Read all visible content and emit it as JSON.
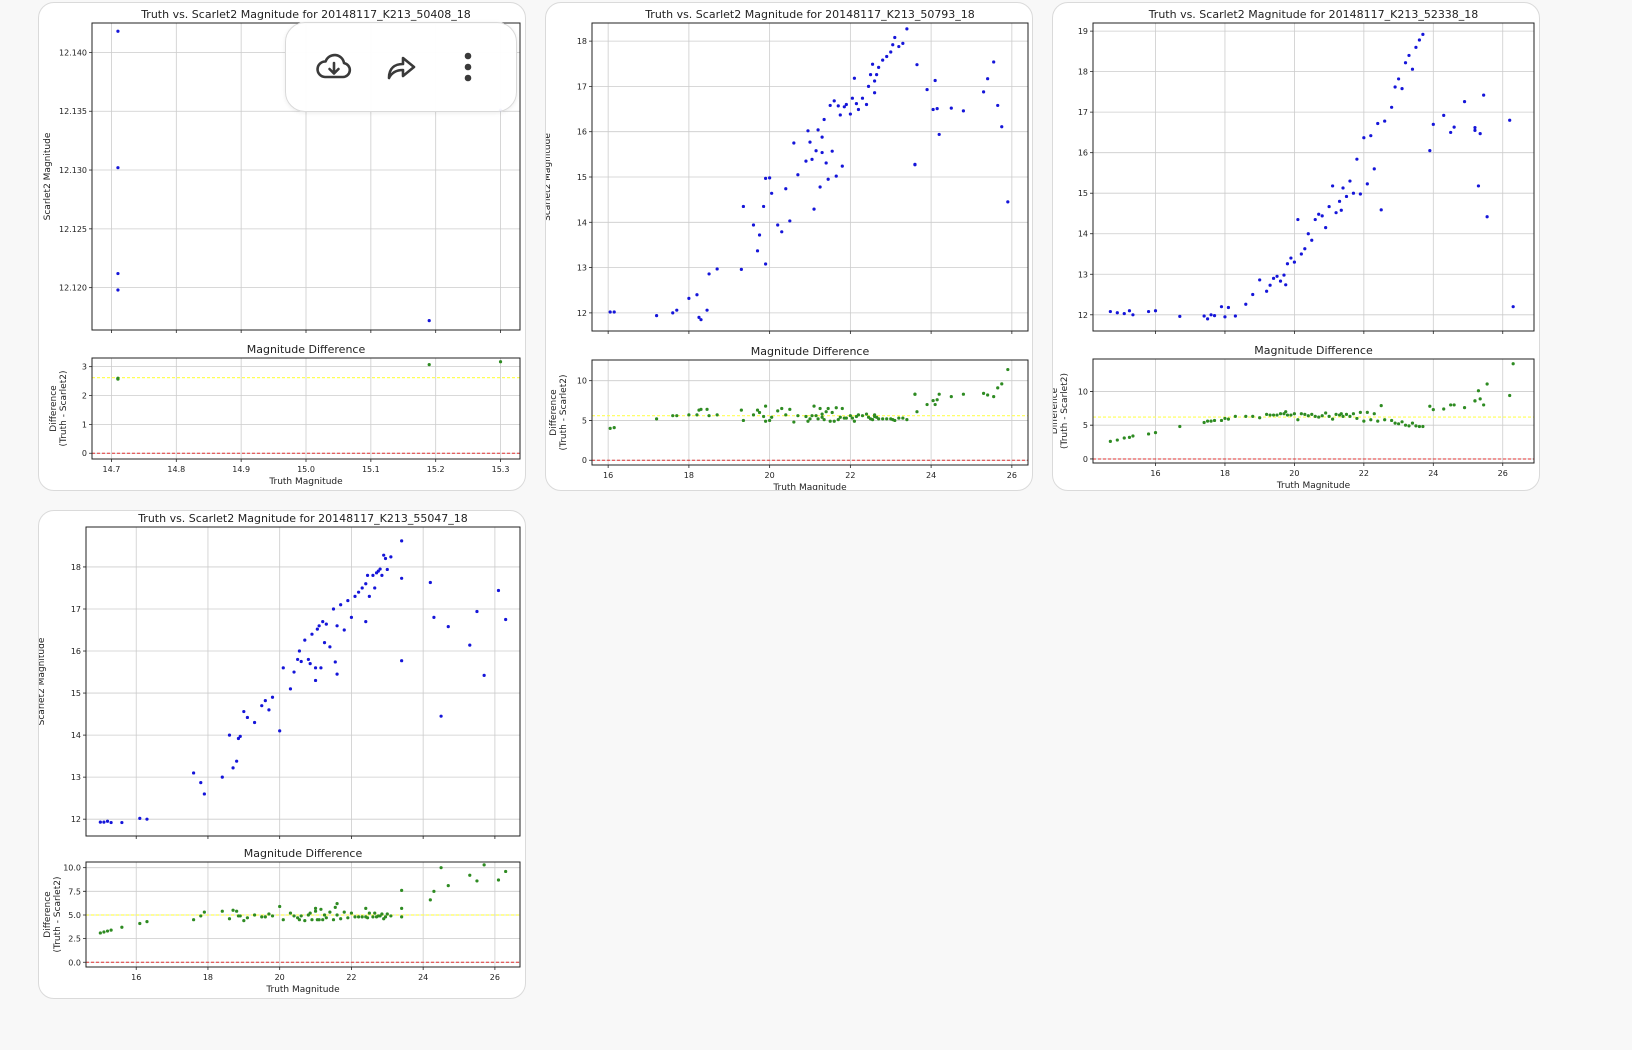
{
  "menu": {
    "icons": [
      "cloud-download-icon",
      "share-arrow-icon",
      "more-vertical-icon"
    ]
  },
  "colors": {
    "scatter": "#1515d9",
    "diff": "#2e8b22",
    "yellow_line": "#ffff55",
    "red_line": "#e03030",
    "grid": "#cccccc"
  },
  "chart_data": [
    {
      "type": "scatter",
      "title": "Truth vs. Scarlet2 Magnitude for 20148117_K213_50408_18",
      "ylabel": "Scarlet2 Magnitude",
      "diff_title": "Magnitude Difference",
      "diff_ylabel_1": "Difference",
      "diff_ylabel_2": "(Truth - Scarlet2)",
      "xlabel": "Truth Magnitude",
      "xlim": [
        14.67,
        15.33
      ],
      "xticks": [
        "14.7",
        "14.8",
        "14.9",
        "15.0",
        "15.1",
        "15.2",
        "15.3"
      ],
      "xtick_values": [
        14.7,
        14.8,
        14.9,
        15.0,
        15.1,
        15.2,
        15.3
      ],
      "ylim": [
        12.1164,
        12.1425
      ],
      "yticks": [
        "12.120",
        "12.125",
        "12.130",
        "12.135",
        "12.140"
      ],
      "ytick_values": [
        12.12,
        12.125,
        12.13,
        12.135,
        12.14
      ],
      "dylim": [
        -0.2,
        3.3
      ],
      "dyticks": [
        "0",
        "1",
        "2",
        "3"
      ],
      "dytick_values": [
        0,
        1,
        2,
        3
      ],
      "mean_diff": 2.62,
      "x": [
        14.71,
        14.71,
        14.71,
        14.71,
        15.19,
        15.3
      ],
      "y": [
        12.1418,
        12.1302,
        12.1212,
        12.1198,
        12.1172,
        12.1351
      ],
      "diff": [
        2.57,
        2.58,
        2.59,
        2.6,
        3.07,
        3.17
      ]
    },
    {
      "type": "scatter",
      "title": "Truth vs. Scarlet2 Magnitude for 20148117_K213_50793_18",
      "ylabel": "Scarlet2 Magnitude",
      "diff_title": "Magnitude Difference",
      "diff_ylabel_1": "Difference",
      "diff_ylabel_2": "(Truth - Scarlet2)",
      "xlabel": "Truth Magnitude",
      "xlim": [
        15.6,
        26.4
      ],
      "xticks": [
        "16",
        "18",
        "20",
        "22",
        "24",
        "26"
      ],
      "xtick_values": [
        16,
        18,
        20,
        22,
        24,
        26
      ],
      "ylim": [
        11.6,
        18.4
      ],
      "yticks": [
        "12",
        "13",
        "14",
        "15",
        "16",
        "17",
        "18"
      ],
      "ytick_values": [
        12,
        13,
        14,
        15,
        16,
        17,
        18
      ],
      "dylim": [
        -0.6,
        12.6
      ],
      "dyticks": [
        "0",
        "5",
        "10"
      ],
      "dytick_values": [
        0,
        5,
        10
      ],
      "mean_diff": 5.6,
      "x": [
        16.05,
        16.15,
        17.2,
        17.6,
        17.7,
        18.0,
        18.2,
        18.25,
        18.3,
        18.45,
        18.5,
        18.7,
        19.3,
        19.35,
        19.6,
        19.7,
        19.75,
        19.85,
        19.9,
        20.0,
        20.05,
        20.2,
        20.3,
        20.5,
        20.6,
        20.7,
        20.9,
        20.95,
        21.0,
        21.05,
        21.1,
        21.15,
        21.2,
        21.25,
        21.3,
        21.35,
        21.4,
        21.45,
        21.5,
        21.55,
        21.6,
        21.65,
        21.7,
        21.75,
        21.8,
        21.85,
        21.9,
        22.0,
        22.05,
        22.1,
        22.15,
        22.2,
        22.3,
        22.4,
        22.45,
        22.5,
        22.55,
        22.6,
        22.65,
        22.7,
        22.8,
        22.9,
        23.0,
        23.05,
        23.1,
        23.2,
        23.3,
        23.4,
        23.6,
        23.65,
        23.9,
        24.05,
        24.15,
        24.2,
        24.5,
        24.8,
        25.3,
        25.4,
        25.55,
        25.65,
        25.75,
        25.9,
        24.1,
        23.6,
        21.3,
        20.4,
        19.9,
        22.6
      ],
      "y": [
        12.02,
        12.02,
        11.94,
        12.0,
        12.06,
        12.32,
        12.4,
        11.9,
        11.85,
        12.06,
        12.86,
        12.97,
        12.96,
        14.35,
        13.94,
        13.37,
        13.72,
        14.35,
        13.08,
        14.98,
        14.64,
        13.94,
        13.79,
        14.03,
        15.75,
        15.05,
        15.35,
        16.02,
        15.77,
        15.39,
        14.29,
        15.58,
        16.04,
        14.78,
        15.88,
        16.27,
        15.31,
        14.95,
        16.58,
        15.57,
        16.68,
        15.02,
        16.57,
        16.37,
        15.24,
        16.55,
        16.6,
        16.39,
        16.74,
        17.18,
        16.62,
        16.49,
        16.74,
        16.6,
        17.0,
        17.26,
        17.49,
        17.12,
        17.26,
        17.42,
        17.58,
        17.66,
        17.76,
        17.92,
        18.08,
        17.88,
        17.95,
        18.27,
        15.28,
        17.48,
        16.93,
        16.49,
        16.51,
        15.94,
        16.52,
        16.46,
        16.88,
        17.17,
        17.54,
        16.58,
        16.11,
        14.45,
        17.13,
        15.27,
        15.54,
        14.74,
        14.97,
        16.86
      ],
      "diff": [
        4.0,
        4.1,
        5.2,
        5.6,
        5.6,
        5.7,
        5.7,
        6.3,
        6.4,
        6.4,
        5.6,
        5.7,
        6.3,
        5.0,
        5.7,
        6.3,
        6.0,
        5.5,
        6.8,
        5.0,
        5.4,
        6.2,
        6.5,
        6.4,
        4.8,
        5.6,
        5.5,
        4.9,
        5.2,
        5.6,
        6.8,
        5.6,
        5.2,
        6.5,
        5.4,
        5.1,
        6.1,
        6.5,
        4.9,
        6.0,
        4.9,
        6.6,
        5.1,
        5.4,
        6.5,
        5.3,
        5.3,
        5.6,
        5.3,
        4.9,
        5.5,
        5.7,
        5.6,
        5.8,
        5.4,
        5.2,
        5.1,
        5.5,
        5.4,
        5.2,
        5.2,
        5.2,
        5.2,
        5.1,
        5.0,
        5.3,
        5.3,
        5.1,
        8.3,
        6.1,
        7.0,
        7.5,
        7.6,
        8.3,
        8.0,
        8.3,
        8.4,
        8.2,
        8.0,
        9.1,
        9.6,
        11.4,
        7.0,
        8.3,
        5.8,
        5.7,
        4.9,
        5.7
      ]
    },
    {
      "type": "scatter",
      "title": "Truth vs. Scarlet2 Magnitude for 20148117_K213_52338_18",
      "ylabel": "Scarlet2 Magnitude",
      "diff_title": "Magnitude Difference",
      "diff_ylabel_1": "Difference",
      "diff_ylabel_2": "(Truth - Scarlet2)",
      "xlabel": "Truth Magnitude",
      "xlim": [
        14.2,
        26.9
      ],
      "xticks": [
        "16",
        "18",
        "20",
        "22",
        "24",
        "26"
      ],
      "xtick_values": [
        16,
        18,
        20,
        22,
        24,
        26
      ],
      "ylim": [
        11.6,
        19.2
      ],
      "yticks": [
        "12",
        "13",
        "14",
        "15",
        "16",
        "17",
        "18",
        "19"
      ],
      "ytick_values": [
        12,
        13,
        14,
        15,
        16,
        17,
        18,
        19
      ],
      "dylim": [
        -0.6,
        14.8
      ],
      "dyticks": [
        "0",
        "5",
        "10"
      ],
      "dytick_values": [
        0,
        5,
        10
      ],
      "mean_diff": 6.2,
      "x": [
        14.7,
        14.9,
        15.1,
        15.25,
        15.35,
        15.8,
        16.0,
        16.7,
        17.4,
        17.5,
        17.6,
        17.7,
        17.9,
        18.0,
        18.1,
        18.3,
        18.6,
        18.8,
        19.0,
        19.2,
        19.3,
        19.4,
        19.5,
        19.6,
        19.7,
        19.75,
        19.8,
        19.9,
        20.0,
        20.1,
        20.2,
        20.3,
        20.4,
        20.5,
        20.6,
        20.7,
        20.8,
        20.9,
        21.0,
        21.1,
        21.2,
        21.3,
        21.35,
        21.4,
        21.5,
        21.6,
        21.7,
        21.8,
        21.9,
        22.0,
        22.1,
        22.2,
        22.3,
        22.4,
        22.5,
        22.6,
        22.8,
        22.9,
        23.0,
        23.1,
        23.2,
        23.3,
        23.4,
        23.5,
        23.6,
        23.7,
        23.9,
        24.0,
        24.3,
        24.5,
        24.6,
        24.9,
        25.2,
        25.3,
        25.35,
        25.45,
        25.55,
        26.2,
        26.3,
        25.2
      ],
      "y": [
        12.08,
        12.05,
        12.03,
        12.1,
        12.0,
        12.08,
        12.1,
        11.96,
        11.97,
        11.9,
        12.0,
        11.98,
        12.2,
        11.95,
        12.18,
        11.97,
        12.26,
        12.5,
        12.86,
        12.58,
        12.73,
        12.9,
        12.95,
        12.83,
        12.98,
        12.74,
        13.26,
        13.4,
        13.3,
        14.35,
        13.5,
        13.63,
        14.0,
        13.84,
        14.35,
        14.48,
        14.44,
        14.15,
        14.67,
        15.18,
        14.52,
        14.8,
        14.58,
        15.13,
        14.92,
        15.3,
        15.0,
        15.84,
        14.98,
        16.37,
        15.23,
        16.42,
        15.6,
        16.72,
        14.59,
        16.78,
        17.12,
        17.62,
        17.82,
        17.58,
        18.22,
        18.4,
        18.06,
        18.6,
        18.78,
        18.92,
        16.05,
        16.7,
        16.92,
        16.5,
        16.63,
        17.26,
        16.62,
        15.18,
        16.47,
        17.42,
        14.42,
        16.8,
        12.2,
        16.55
      ],
      "diff": [
        2.6,
        2.8,
        3.1,
        3.2,
        3.4,
        3.7,
        3.9,
        4.8,
        5.4,
        5.6,
        5.6,
        5.7,
        5.7,
        6.0,
        5.9,
        6.3,
        6.3,
        6.3,
        6.1,
        6.6,
        6.5,
        6.5,
        6.5,
        6.7,
        6.7,
        7.0,
        6.5,
        6.5,
        6.7,
        5.8,
        6.7,
        6.6,
        6.4,
        6.6,
        6.3,
        6.2,
        6.4,
        6.8,
        6.3,
        5.9,
        6.6,
        6.5,
        6.7,
        6.3,
        6.6,
        6.3,
        6.7,
        6.0,
        6.9,
        5.6,
        6.9,
        5.8,
        6.7,
        5.6,
        7.9,
        5.8,
        5.7,
        5.3,
        5.2,
        5.5,
        5.0,
        4.9,
        5.3,
        4.9,
        4.8,
        4.8,
        7.8,
        7.3,
        7.4,
        8.0,
        8.0,
        7.6,
        8.6,
        10.1,
        8.9,
        8.0,
        11.1,
        9.4,
        14.1,
        8.6
      ]
    },
    {
      "type": "scatter",
      "title": "Truth vs. Scarlet2 Magnitude for 20148117_K213_55047_18",
      "ylabel": "Scarlet2 Magnitude",
      "diff_title": "Magnitude Difference",
      "diff_ylabel_1": "Difference",
      "diff_ylabel_2": "(Truth - Scarlet2)",
      "xlabel": "Truth Magnitude",
      "xlim": [
        14.6,
        26.7
      ],
      "xticks": [
        "16",
        "18",
        "20",
        "22",
        "24",
        "26"
      ],
      "xtick_values": [
        16,
        18,
        20,
        22,
        24,
        26
      ],
      "ylim": [
        11.6,
        18.95
      ],
      "yticks": [
        "12",
        "13",
        "14",
        "15",
        "16",
        "17",
        "18"
      ],
      "ytick_values": [
        12,
        13,
        14,
        15,
        16,
        17,
        18
      ],
      "dylim": [
        -0.5,
        10.6
      ],
      "dyticks": [
        "0.0",
        "2.5",
        "5.0",
        "7.5",
        "10.0"
      ],
      "dytick_values": [
        0,
        2.5,
        5,
        7.5,
        10
      ],
      "mean_diff": 5.0,
      "x": [
        15.0,
        15.1,
        15.2,
        15.3,
        15.6,
        16.1,
        16.3,
        17.6,
        17.8,
        17.9,
        18.4,
        18.6,
        18.7,
        18.8,
        18.85,
        18.9,
        19.0,
        19.1,
        19.3,
        19.5,
        19.6,
        19.7,
        19.8,
        20.0,
        20.1,
        20.3,
        20.4,
        20.5,
        20.55,
        20.6,
        20.7,
        20.8,
        20.85,
        20.9,
        21.0,
        21.05,
        21.1,
        21.15,
        21.2,
        21.25,
        21.3,
        21.4,
        21.5,
        21.55,
        21.6,
        21.7,
        21.8,
        21.9,
        22.0,
        22.1,
        22.2,
        22.3,
        22.4,
        22.45,
        22.5,
        22.6,
        22.65,
        22.7,
        22.75,
        22.8,
        22.85,
        22.9,
        22.95,
        23.0,
        23.1,
        23.4,
        23.4,
        23.4,
        24.2,
        24.3,
        24.5,
        24.7,
        25.3,
        25.5,
        25.7,
        26.1,
        26.3,
        21.0,
        21.6,
        22.4
      ],
      "y": [
        11.93,
        11.93,
        11.95,
        11.92,
        11.92,
        12.02,
        12.0,
        13.1,
        12.87,
        12.6,
        13.0,
        14.0,
        13.22,
        13.38,
        13.92,
        13.97,
        14.56,
        14.42,
        14.3,
        14.7,
        14.82,
        14.6,
        14.9,
        14.1,
        15.6,
        15.1,
        15.5,
        15.8,
        16.0,
        15.75,
        16.26,
        15.8,
        15.7,
        16.4,
        15.6,
        16.52,
        16.6,
        15.6,
        16.7,
        16.2,
        16.64,
        16.1,
        17.0,
        15.74,
        16.6,
        17.1,
        16.5,
        17.2,
        16.8,
        17.3,
        17.4,
        17.5,
        17.6,
        17.8,
        17.3,
        17.8,
        17.5,
        17.86,
        17.9,
        17.95,
        17.8,
        18.28,
        18.2,
        17.94,
        18.24,
        18.62,
        17.73,
        15.77,
        17.63,
        16.8,
        14.45,
        16.58,
        16.14,
        16.94,
        15.42,
        17.44,
        16.75,
        15.3,
        15.45,
        16.7
      ],
      "diff": [
        3.1,
        3.2,
        3.3,
        3.4,
        3.7,
        4.1,
        4.3,
        4.5,
        4.9,
        5.3,
        5.4,
        4.6,
        5.5,
        5.4,
        4.9,
        4.9,
        4.4,
        4.7,
        5.0,
        4.8,
        4.8,
        5.1,
        4.9,
        5.9,
        4.5,
        5.2,
        4.9,
        4.7,
        4.5,
        4.9,
        4.4,
        5.0,
        5.2,
        4.5,
        5.4,
        4.5,
        4.5,
        5.6,
        4.5,
        5.0,
        4.7,
        5.3,
        4.5,
        5.8,
        5.0,
        4.6,
        5.3,
        4.7,
        5.2,
        4.8,
        4.8,
        4.8,
        4.8,
        4.7,
        5.2,
        4.8,
        5.2,
        4.8,
        4.9,
        4.9,
        5.1,
        4.6,
        4.8,
        5.1,
        4.9,
        4.8,
        5.7,
        7.6,
        6.6,
        7.5,
        10.0,
        8.1,
        9.2,
        8.6,
        10.3,
        8.7,
        9.6,
        5.7,
        6.2,
        5.7
      ]
    }
  ]
}
